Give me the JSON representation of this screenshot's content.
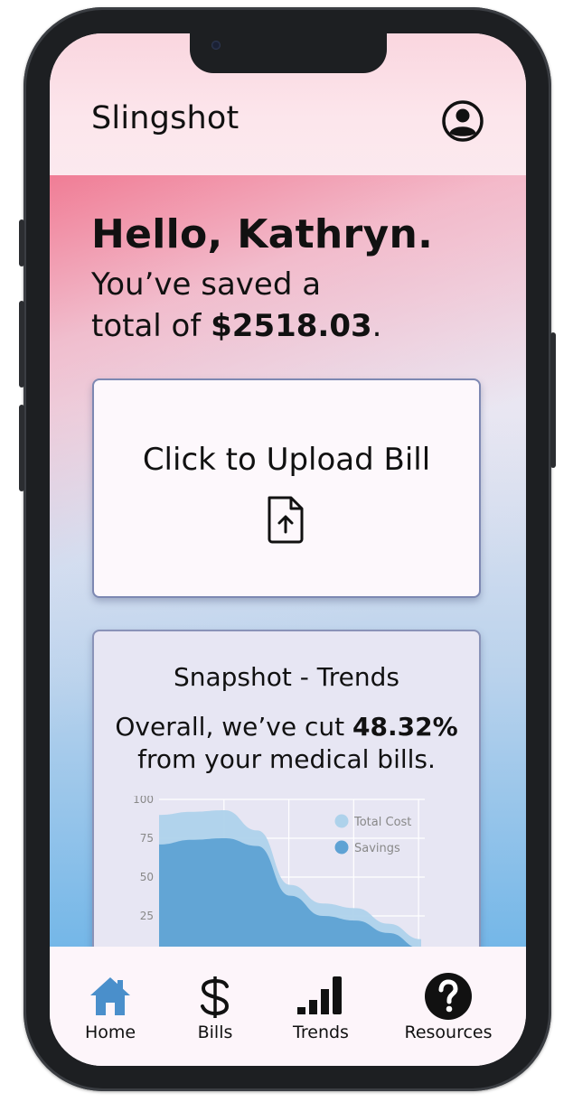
{
  "app": {
    "title": "Slingshot"
  },
  "greeting": {
    "hello": "Hello, Kathryn.",
    "saved_line1": "You’ve saved a",
    "saved_prefix": "total of",
    "saved_amount": "$2518.03",
    "saved_suffix": "."
  },
  "upload": {
    "label": "Click to Upload Bill",
    "icon": "file-upload-icon"
  },
  "trends": {
    "title": "Snapshot - Trends",
    "summary_prefix": "Overall, we’ve cut",
    "summary_percent": "48.32%",
    "summary_suffix": "from your medical bills."
  },
  "chart_data": {
    "type": "area",
    "yticks": [
      "100",
      "75",
      "50",
      "25"
    ],
    "ylim": [
      0,
      100
    ],
    "x": [
      0,
      1,
      2,
      3,
      4,
      5,
      6,
      7,
      8
    ],
    "series": [
      {
        "name": "Total Cost",
        "color": "#aed2eb",
        "values": [
          90,
          92,
          93,
          80,
          45,
          33,
          30,
          20,
          10
        ]
      },
      {
        "name": "Savings",
        "color": "#5ea2d4",
        "values": [
          71,
          74,
          75,
          70,
          38,
          25,
          22,
          14,
          4
        ]
      }
    ],
    "legend": [
      "Total Cost",
      "Savings"
    ],
    "legend_position": "top-right",
    "grid": true
  },
  "tabbar": {
    "items": [
      {
        "label": "Home",
        "icon": "home-icon",
        "active": true
      },
      {
        "label": "Bills",
        "icon": "dollar-icon"
      },
      {
        "label": "Trends",
        "icon": "bar-chart-icon"
      },
      {
        "label": "Resources",
        "icon": "question-circle-icon"
      }
    ]
  },
  "colors": {
    "accent": "#4a8fcb",
    "header_bg": "#fce6ec",
    "card_border": "#7d88b2"
  }
}
